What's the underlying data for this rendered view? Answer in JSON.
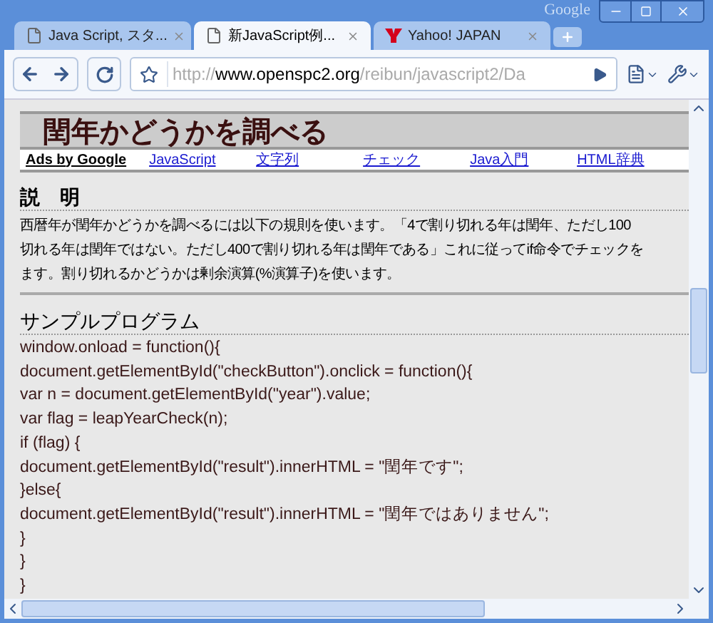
{
  "window": {
    "brand": "Google"
  },
  "tabs": [
    {
      "title": "Java Script, スタ...",
      "kind": "page",
      "selected": false
    },
    {
      "title": "新JavaScript例...",
      "kind": "page",
      "selected": true
    },
    {
      "title": "Yahoo!  JAPAN",
      "kind": "logo",
      "selected": false
    }
  ],
  "address": {
    "scheme": "http://",
    "host": "www.openspc2.org",
    "path": "/reibun/javascript2/Da"
  },
  "page": {
    "title": "閏年かどうかを調べる",
    "ads": {
      "label": "Ads by Google",
      "links": [
        "JavaScript",
        "文字列",
        "チェック",
        "Java入門",
        "HTML辞典"
      ]
    },
    "description": {
      "heading": "説　明",
      "lines": [
        "西暦年が閏年かどうかを調べるには以下の規則を使います。「4で割り切れる年は閏年、ただし100",
        "切れる年は閏年ではない。ただし400で割り切れる年は閏年である」これに従ってif命令でチェックを",
        "ます。割り切れるかどうかは剰余演算(%演算子)を使います。"
      ]
    },
    "sample": {
      "heading": "サンプルプログラム",
      "code": [
        "window.onload = function(){",
        "document.getElementById(\"checkButton\").onclick = function(){",
        "var n = document.getElementById(\"year\").value;",
        "var flag = leapYearCheck(n);",
        "if (flag) {",
        "document.getElementById(\"result\").innerHTML = \"閏年です\";",
        "}else{",
        "document.getElementById(\"result\").innerHTML = \"閏年ではありません\";",
        "}",
        "}",
        "}"
      ]
    }
  }
}
